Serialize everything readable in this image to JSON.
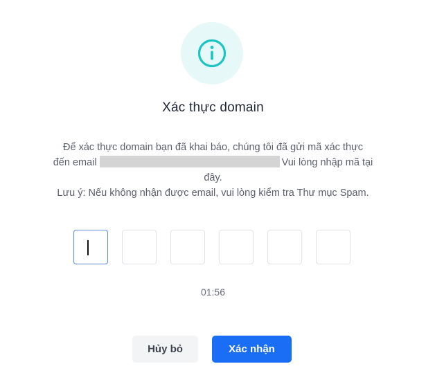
{
  "dialog": {
    "icon": "info-icon",
    "accent_color": "#1cc4c4",
    "title": "Xác thực domain",
    "description": {
      "line1": "Để xác thực domain bạn đã khai báo, chúng tôi đã gửi mã xác thực",
      "line2_prefix": "đến email",
      "line2_suffix": "Vui lòng nhập mã tại",
      "line3": "đây.",
      "note": "Lưu ý: Nếu không nhận được email, vui lòng kiểm tra Thư mục Spam."
    },
    "otp": {
      "length": 6,
      "values": [
        "",
        "",
        "",
        "",
        "",
        ""
      ],
      "active_index": 0
    },
    "timer": "01:56",
    "buttons": {
      "cancel_label": "Hủy bỏ",
      "confirm_label": "Xác nhận",
      "confirm_color": "#1a6ef5"
    }
  }
}
